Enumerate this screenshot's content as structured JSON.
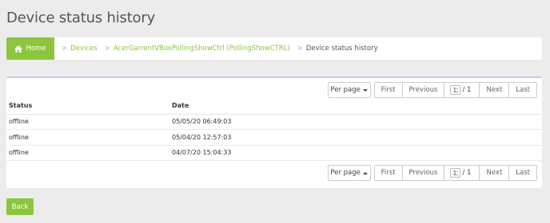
{
  "page": {
    "title": "Device status history"
  },
  "breadcrumb": {
    "home_label": "Home",
    "separator": ">",
    "devices_label": "Devices",
    "device_label": "AcerGarrentVBoxPollingShowCtrl (PollingShowCTRL)",
    "current_label": "Device status history"
  },
  "pager_top": {
    "per_page_label": "Per page",
    "first_label": "First",
    "previous_label": "Previous",
    "page_value": "1",
    "page_total": "/ 1",
    "next_label": "Next",
    "last_label": "Last"
  },
  "pager_bottom": {
    "per_page_label": "Per page",
    "first_label": "First",
    "previous_label": "Previous",
    "page_value": "1",
    "page_total": "/ 1",
    "next_label": "Next",
    "last_label": "Last"
  },
  "table": {
    "headers": [
      "Status",
      "Date"
    ],
    "rows": [
      {
        "status": "offline",
        "date": "05/05/20 06:49:03"
      },
      {
        "status": "offline",
        "date": "05/04/20 12:57:03"
      },
      {
        "status": "offline",
        "date": "04/07/20 15:04:33"
      }
    ]
  },
  "back_label": "Back",
  "colors": {
    "accent": "#8cc63f",
    "background": "#ececec",
    "panel_border": "#c9c9e9"
  }
}
